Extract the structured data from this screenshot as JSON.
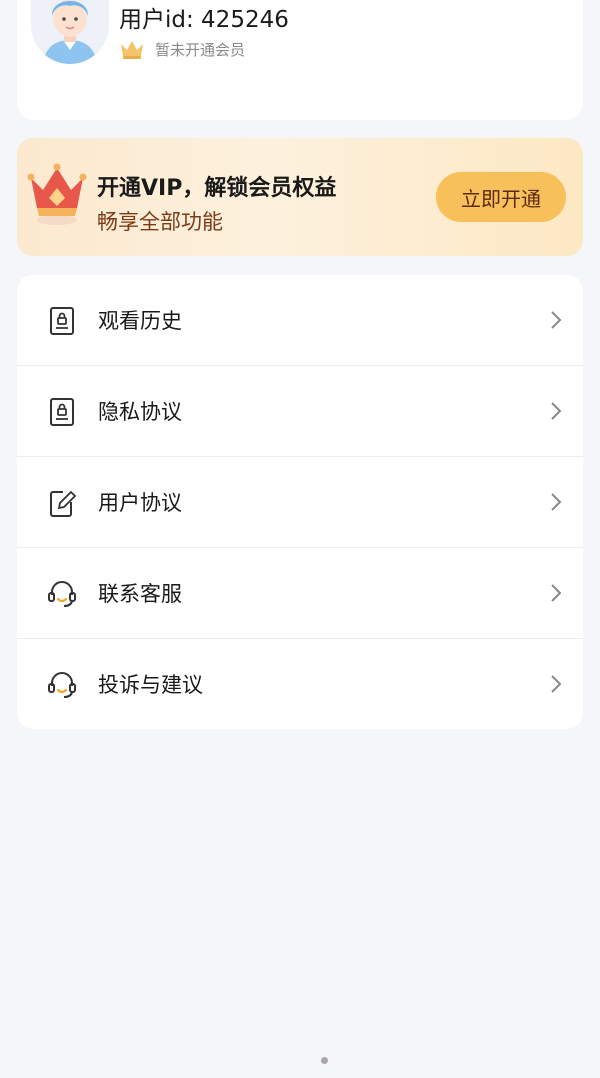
{
  "profile": {
    "user_id_text": "用户id: 425246",
    "member_status": "暂未开通会员"
  },
  "vip": {
    "title": "开通VIP，解锁会员权益",
    "subtitle": "畅享全部功能",
    "button_label": "立即开通"
  },
  "menu": {
    "items": [
      {
        "label": "观看历史",
        "icon": "lock-document-icon"
      },
      {
        "label": "隐私协议",
        "icon": "lock-document-icon"
      },
      {
        "label": "用户协议",
        "icon": "edit-document-icon"
      },
      {
        "label": "联系客服",
        "icon": "headset-icon"
      },
      {
        "label": "投诉与建议",
        "icon": "headset-icon"
      }
    ]
  },
  "colors": {
    "background": "#f5f6f9",
    "vip_button": "#f7c05a",
    "vip_subtitle": "#7a3b16"
  }
}
